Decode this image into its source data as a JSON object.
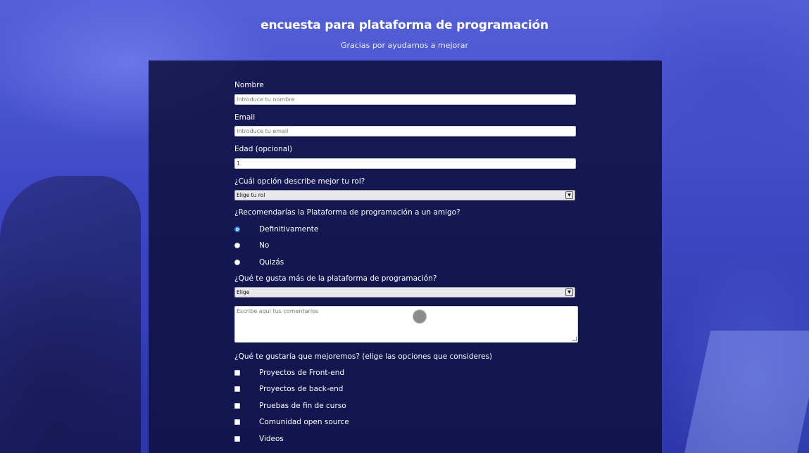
{
  "header": {
    "title": "encuesta para plataforma de programación",
    "subtitle": "Gracias por ayudarnos a mejorar"
  },
  "form": {
    "name": {
      "label": "Nombre",
      "placeholder": "Introduce tu nombre"
    },
    "email": {
      "label": "Email",
      "placeholder": "Introduce tu email"
    },
    "age": {
      "label": "Edad (opcional)",
      "value": "1"
    },
    "role": {
      "label": "¿Cuál opción describe mejor tu rol?",
      "selected": "Elige tu rol"
    },
    "recommend": {
      "label": "¿Recomendarías la Plataforma de programación a un amigo?",
      "options": [
        {
          "label": "Definitivamente",
          "checked": true
        },
        {
          "label": "No",
          "checked": false
        },
        {
          "label": "Quizás",
          "checked": false
        }
      ]
    },
    "favorite": {
      "label": "¿Qué te gusta más de la plataforma de programación?",
      "selected": "Elige"
    },
    "comments": {
      "placeholder": "Escribe aquí tus comentarios"
    },
    "improve": {
      "label": "¿Qué te gustaría que mejoremos? (elige las opciones que consideres)",
      "options": [
        {
          "label": "Proyectos de Front-end",
          "checked": false
        },
        {
          "label": "Proyectos de back-end",
          "checked": false
        },
        {
          "label": "Pruebas de fin de curso",
          "checked": false
        },
        {
          "label": "Comunidad open source",
          "checked": false
        },
        {
          "label": "Videos",
          "checked": false
        }
      ]
    }
  },
  "colors": {
    "accent_radio": "#2f7ff0",
    "card_bg": "#0c0e3c"
  }
}
